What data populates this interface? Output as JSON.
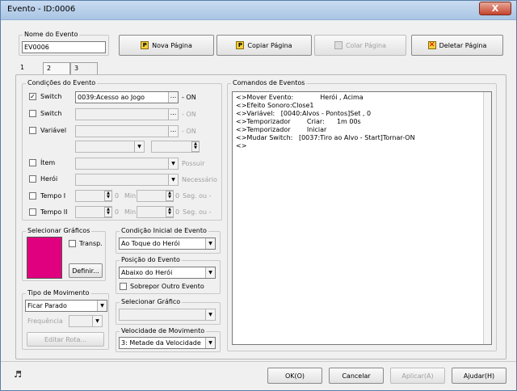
{
  "window": {
    "title": "Evento - ID:0006",
    "close": "X"
  },
  "event_name": {
    "legend": "Nome do Evento",
    "value": "EV0006"
  },
  "toolbar": {
    "new_page": "Nova Página",
    "copy_page": "Copiar Página",
    "paste_page": "Colar Página",
    "delete_page": "Deletar Página"
  },
  "tabs": [
    "1",
    "2",
    "3"
  ],
  "conditions": {
    "legend": "Condições do Evento",
    "switch1": {
      "label": "Switch",
      "value": "0039:Acesso ao Jogo",
      "suffix": "- ON",
      "checked": "✓"
    },
    "switch2": {
      "label": "Switch",
      "suffix": "- ON"
    },
    "variable": {
      "label": "Variável",
      "suffix": "- ON"
    },
    "item": {
      "label": "Ítem",
      "suffix": "Possuir"
    },
    "hero": {
      "label": "Herói",
      "suffix": "Necessário"
    },
    "timer1": {
      "label": "Tempo I",
      "min": "Min",
      "sec": "Seg. ou -"
    },
    "timer2": {
      "label": "Tempo II",
      "min": "Min",
      "sec": "Seg. ou -"
    },
    "ellipsis": "...",
    "spin_zero": "0"
  },
  "graphics": {
    "legend": "Selecionar Gráficos",
    "transp": "Transp.",
    "define": "Definir...",
    "color": "#e0007f"
  },
  "start_condition": {
    "legend": "Condição Inicial de Evento",
    "value": "Ao Toque do Herói"
  },
  "event_position": {
    "legend": "Posição do Evento",
    "value": "Abaixo do Herói",
    "overlap": "Sobrepor Outro Evento"
  },
  "select_graphic": {
    "legend": "Selecionar Gráfico"
  },
  "movement_type": {
    "legend": "Tipo de Movimento",
    "value": "Ficar Parado",
    "frequency": "Frequência",
    "edit_route": "Editar Rota..."
  },
  "move_speed": {
    "legend": "Velocidade de Movimento",
    "value": "3: Metade da Velocidade"
  },
  "commands": {
    "legend": "Comandos de Eventos",
    "lines": [
      "<>Mover Evento:             Herói , Acima",
      "<>Efeito Sonoro:Close1",
      "<>Variável:   [0040:Alvos - Pontos]Set , 0",
      "<>Temporizador        Criar:      1m 00s",
      "<>Temporizador        Iniciar",
      "<>Mudar Switch:   [0037:Tiro ao Alvo - Start]Tornar-ON",
      "<>"
    ]
  },
  "footer": {
    "ok": "OK(O)",
    "cancel": "Cancelar",
    "apply": "Aplicar(A)",
    "help": "Ajudar(H)",
    "music_icon": "♬"
  }
}
